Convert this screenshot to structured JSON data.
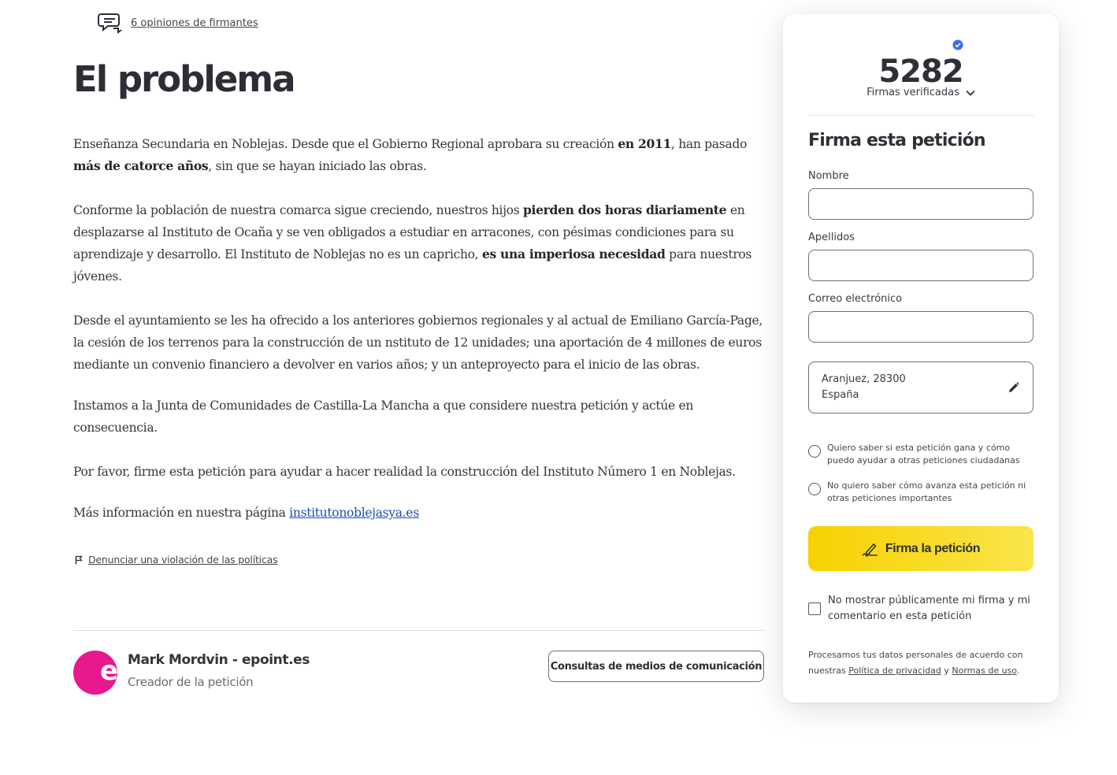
{
  "opinions": {
    "link": "6 opiniones de firmantes"
  },
  "problem": {
    "title": "El problema",
    "p1": {
      "a": "Enseñanza Secundaria en Noblejas. Desde que el Gobierno Regional aprobara su creación ",
      "b": "en 2011",
      "c": ", han pasado ",
      "d": "más de catorce años",
      "e": ", sin que se hayan iniciado las obras."
    },
    "p2": {
      "a": "Conforme la población de nuestra comarca sigue creciendo, nuestros hijos ",
      "b": "pierden dos horas diariamente",
      "c": " en desplazarse al Instituto de Ocaña y se ven obligados a estudiar en arracones, con pésimas condiciones para su aprendizaje y desarrollo. El Instituto de Noblejas no es un capricho, ",
      "d": "es una imperiosa necesidad",
      "e": " para nuestros jóvenes."
    },
    "p3": "Desde el ayuntamiento se les ha ofrecido a los anteriores gobiernos regionales y al actual de Emiliano García-Page, la cesión de los terrenos para la construcción de un nstituto de 12 unidades; una aportación de 4 millones de euros mediante un convenio financiero a devolver en varios años; y un anteproyecto para el inicio de las obras.",
    "p4": "Instamos a la Junta de Comunidades de Castilla-La Mancha a que considere nuestra petición y actúe en consecuencia.",
    "p5": "Por favor, firme esta petición para ayudar a hacer realidad la construcción del Instituto Número 1 en Noblejas.",
    "p6_text": "Más información en nuestra página ",
    "p6_link": "institutonoblejasya.es"
  },
  "report": {
    "link": "Denunciar una violación de las políticas"
  },
  "creator": {
    "avatar_letter": "e",
    "name": "Mark Mordvin - epoint.es",
    "role": "Creador de la petición",
    "avatar_color": "#e8188f"
  },
  "media_button": "Consultas de medios de comunicación",
  "sign_card": {
    "count": "5282",
    "count_label": "Firmas verificadas",
    "form_title": "Firma esta petición",
    "nombre_label": "Nombre",
    "apellidos_label": "Apellidos",
    "correo_label": "Correo electrónico",
    "location_line1": "Aranjuez, 28300",
    "location_line2": "España",
    "radio1": "Quiero saber si esta petición gana y cómo puedo ayudar a otras peticiones ciudadanas",
    "radio2": "No quiero saber cómo avanza esta petición ni otras peticiones importantes",
    "sign_button": "Firma la petición",
    "hide_signature": "No mostrar públicamente mi firma y mi comentario en esta petición",
    "privacy_a": "Procesamos tus datos personales de acuerdo con nuestras ",
    "privacy_link1": "Política de privacidad",
    "privacy_b": " y ",
    "privacy_link2": "Normas de uso",
    "privacy_c": ".",
    "button_color": "#f7d100",
    "verified_color": "#3b6fe0"
  }
}
